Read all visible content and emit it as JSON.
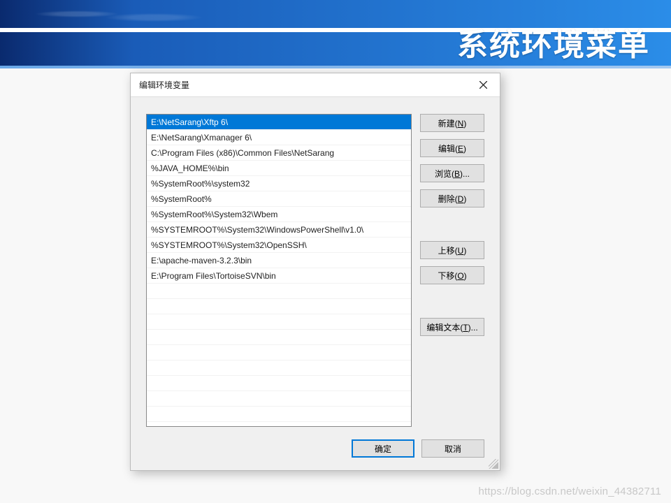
{
  "banner": {
    "title": "系统环境菜单"
  },
  "dialog": {
    "title": "编辑环境变量",
    "list": [
      "E:\\NetSarang\\Xftp 6\\",
      "E:\\NetSarang\\Xmanager 6\\",
      "C:\\Program Files (x86)\\Common Files\\NetSarang",
      "%JAVA_HOME%\\bin",
      "%SystemRoot%\\system32",
      "%SystemRoot%",
      "%SystemRoot%\\System32\\Wbem",
      "%SYSTEMROOT%\\System32\\WindowsPowerShell\\v1.0\\",
      "%SYSTEMROOT%\\System32\\OpenSSH\\",
      "E:\\apache-maven-3.2.3\\bin",
      "E:\\Program Files\\TortoiseSVN\\bin"
    ],
    "selected_index": 0,
    "buttons": {
      "new": {
        "text": "新建",
        "mnemonic": "N"
      },
      "edit": {
        "text": "编辑",
        "mnemonic": "E"
      },
      "browse": {
        "text": "浏览",
        "mnemonic": "B",
        "suffix": "..."
      },
      "delete": {
        "text": "删除",
        "mnemonic": "D"
      },
      "moveup": {
        "text": "上移",
        "mnemonic": "U"
      },
      "movedown": {
        "text": "下移",
        "mnemonic": "O"
      },
      "edittext": {
        "text": "编辑文本",
        "mnemonic": "T",
        "suffix": "..."
      }
    },
    "footer": {
      "ok": "确定",
      "cancel": "取消"
    }
  },
  "watermark": "https://blog.csdn.net/weixin_44382711"
}
